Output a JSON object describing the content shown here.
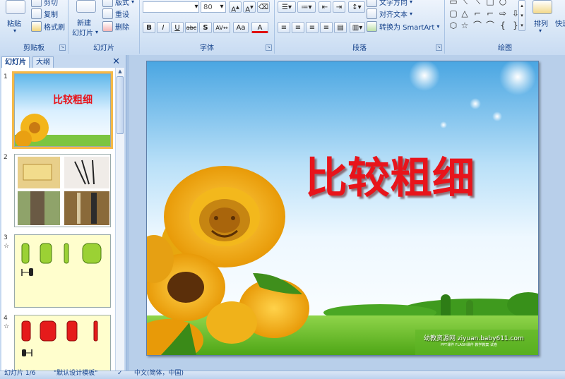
{
  "ribbon": {
    "clipboard": {
      "paste": "粘贴",
      "cut": "剪切",
      "copy": "复制",
      "format_painter": "格式刷",
      "label": "剪贴板"
    },
    "slides": {
      "new_slide": "新建",
      "new_slide2": "幻灯片",
      "layout": "版式",
      "reset": "重设",
      "delete": "删除",
      "label": "幻灯片"
    },
    "font": {
      "font_name": "",
      "font_size": "80",
      "label": "字体"
    },
    "paragraph": {
      "text_direction": "文字方向",
      "align_text": "对齐文本",
      "smartart": "转换为 SmartArt",
      "label": "段落"
    },
    "drawing": {
      "arrange": "排列",
      "quick_styles": "快速",
      "label": "绘图"
    }
  },
  "left_pane": {
    "tabs": [
      "幻灯片",
      "大纲"
    ],
    "slides": [
      {
        "num": "1",
        "title": "比较粗细"
      },
      {
        "num": "2"
      },
      {
        "num": "3"
      },
      {
        "num": "4"
      }
    ]
  },
  "main_slide": {
    "title": "比较粗细",
    "watermark": "幼教资源网 ziyuan.baby611.com",
    "watermark_sub": "PPT课件 FLASH课件 教学教案 试卷"
  },
  "status": {
    "slide_count": "幻灯片 1/6",
    "theme": "\"默认设计模板\"",
    "language": "中文(简体，中国)"
  },
  "colors": {
    "title_red": "#e8141b",
    "ribbon_text": "#15428b",
    "selection": "#f5b946"
  }
}
